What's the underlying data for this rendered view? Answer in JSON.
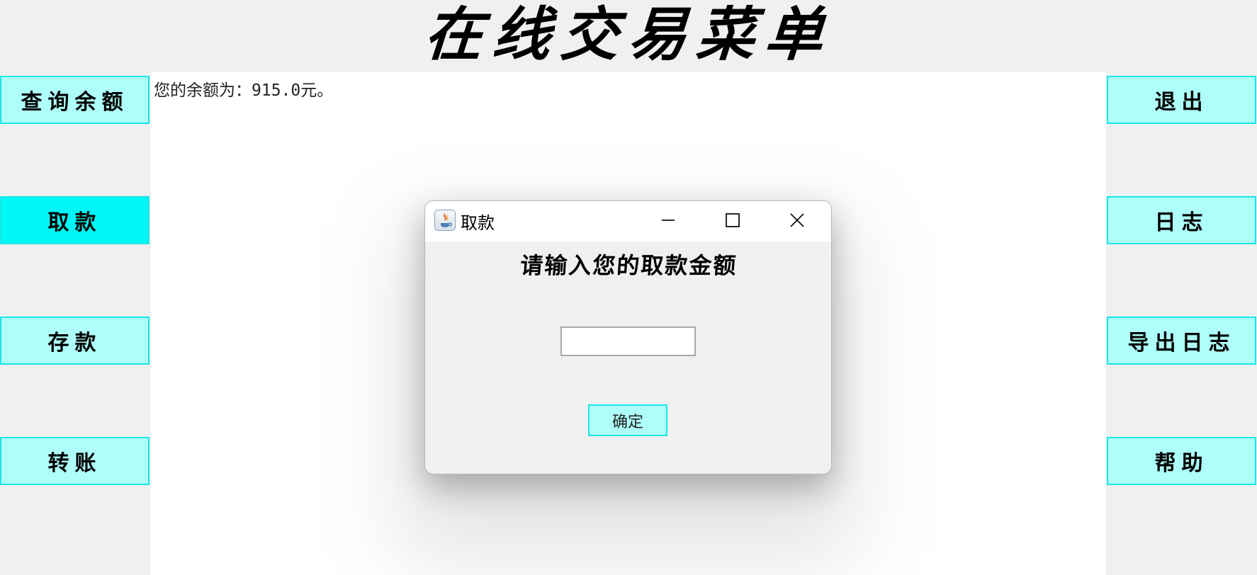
{
  "header": {
    "title": "在线交易菜单"
  },
  "balance": {
    "text": "您的余额为：915.0元。"
  },
  "left_menu": {
    "items": [
      {
        "label": "查询余额"
      },
      {
        "label": "取款"
      },
      {
        "label": "存款"
      },
      {
        "label": "转账"
      }
    ]
  },
  "right_menu": {
    "items": [
      {
        "label": "退出"
      },
      {
        "label": "日志"
      },
      {
        "label": "导出日志"
      },
      {
        "label": "帮助"
      }
    ]
  },
  "dialog": {
    "title": "取款",
    "prompt": "请输入您的取款金额",
    "input_value": "",
    "ok_label": "确定",
    "icon": "java-cup-icon"
  },
  "colors": {
    "button_bg": "#aefff9",
    "button_border": "#19e6e6",
    "active_button_bg": "#00f7f7",
    "content_bg": "#ffffff",
    "window_bg": "#f0f0f0"
  }
}
